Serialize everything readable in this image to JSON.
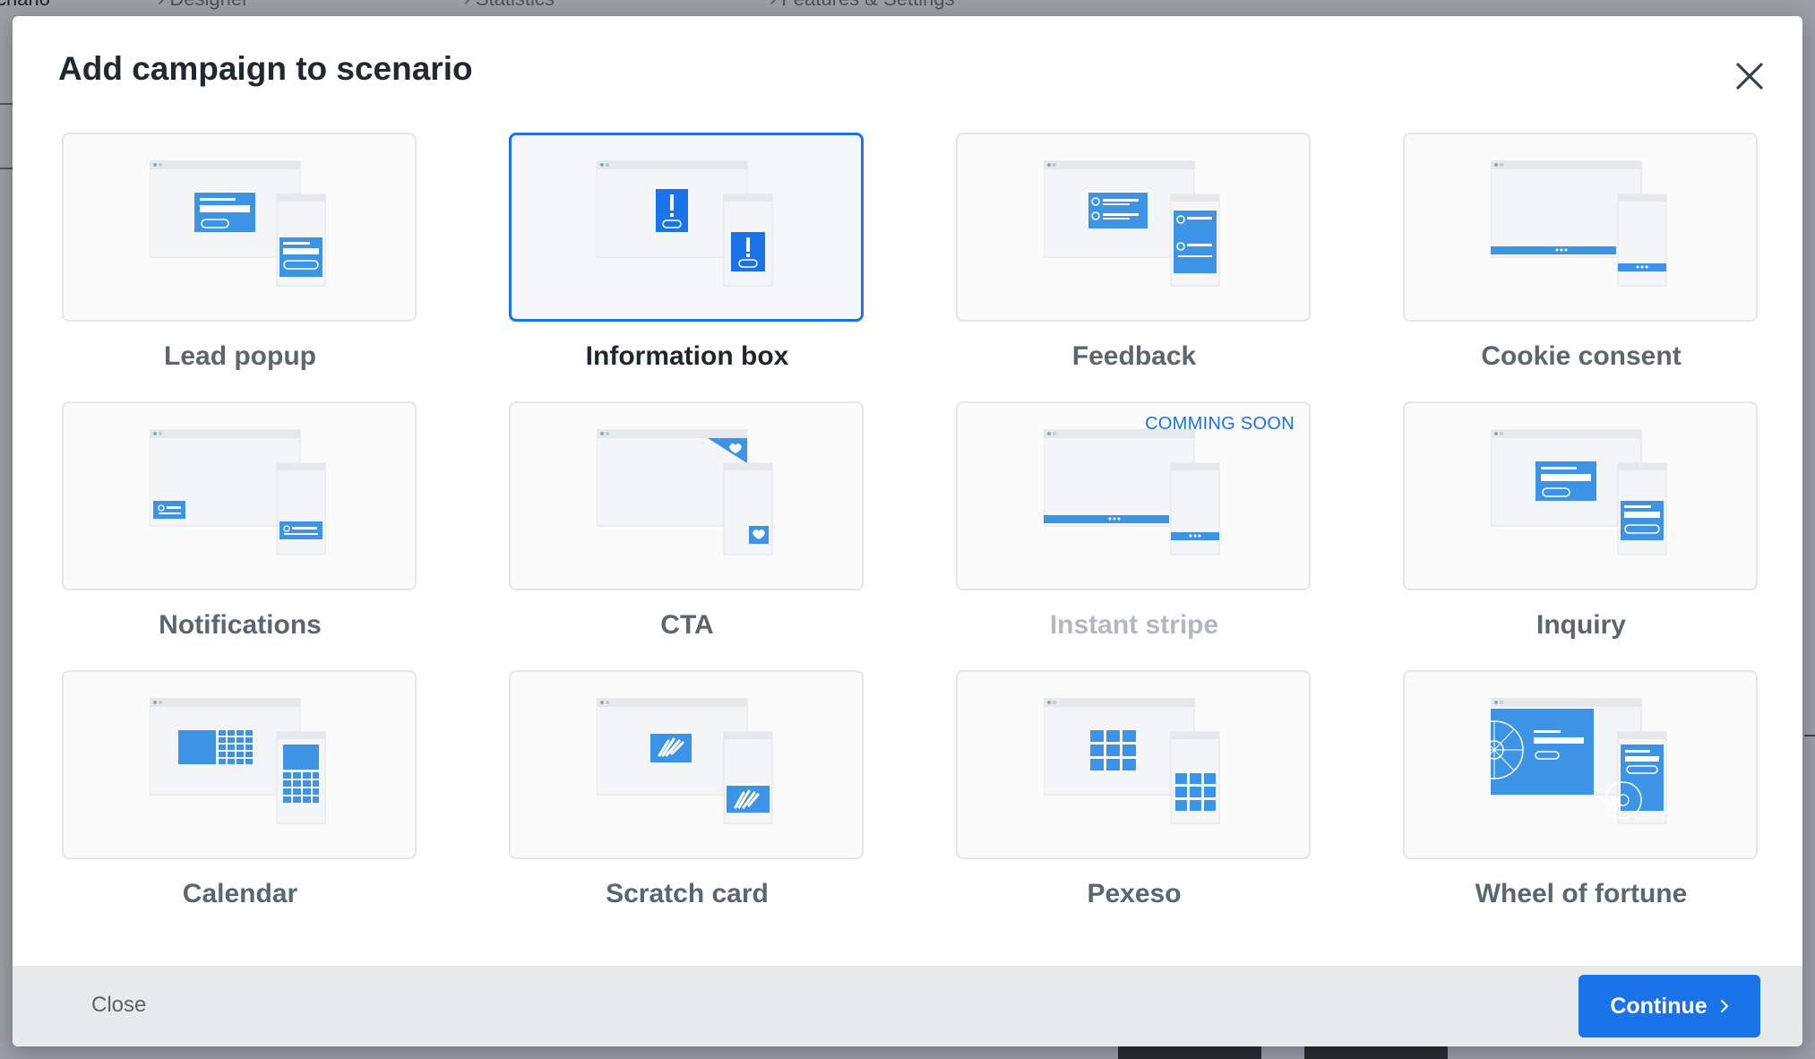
{
  "background": {
    "tabs": [
      "cnario",
      "Designer",
      "Statistics",
      "Features & Settings"
    ]
  },
  "modal": {
    "title": "Add campaign to scenario",
    "close_icon": "close-icon",
    "selected": "Information box",
    "cards": [
      {
        "label": "Lead popup",
        "icon": "lead-popup-illustration"
      },
      {
        "label": "Information box",
        "icon": "information-box-illustration",
        "selected": true
      },
      {
        "label": "Feedback",
        "icon": "feedback-illustration"
      },
      {
        "label": "Cookie consent",
        "icon": "cookie-consent-illustration"
      },
      {
        "label": "Notifications",
        "icon": "notifications-illustration"
      },
      {
        "label": "CTA",
        "icon": "cta-illustration"
      },
      {
        "label": "Instant stripe",
        "icon": "instant-stripe-illustration",
        "disabled": true,
        "badge": "COMMING SOON"
      },
      {
        "label": "Inquiry",
        "icon": "inquiry-illustration"
      },
      {
        "label": "Calendar",
        "icon": "calendar-illustration"
      },
      {
        "label": "Scratch card",
        "icon": "scratch-card-illustration"
      },
      {
        "label": "Pexeso",
        "icon": "pexeso-illustration"
      },
      {
        "label": "Wheel of fortune",
        "icon": "wheel-of-fortune-illustration"
      }
    ]
  },
  "footer": {
    "close_label": "Close",
    "continue_label": "Continue",
    "continue_icon": "chevron-right-icon"
  },
  "colors": {
    "accent": "#1a73e8",
    "illustration_blue": "#3d94e6",
    "card_border": "#e3e6ea",
    "footer_bg": "#e8e9ea"
  }
}
